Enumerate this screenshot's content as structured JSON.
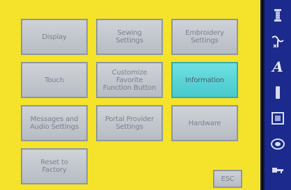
{
  "menu": {
    "display": "Display",
    "sewing_settings": "Sewing\nSettings",
    "embroidery_settings": "Embroidery\nSettings",
    "touch": "Touch",
    "favorite_function_button": "Customize\nFavorite\nFunction Button",
    "information": "Information",
    "messages_audio": "Messages and\nAudio Settings",
    "portal_provider": "Portal Provider\nSettings",
    "hardware": "Hardware",
    "reset_factory": "Reset to\nFactory",
    "esc": "ESC"
  },
  "colors": {
    "background": "#f4e32a",
    "tile": "#c4c8ce",
    "active_tile": "#5fd6d8",
    "sidebar": "#1b2a8c"
  },
  "sidebar": {
    "icons": [
      "spool-icon",
      "needle-icon",
      "letter-a-icon",
      "bar-icon",
      "hoop-icon",
      "bobbin-icon",
      "key-icon"
    ],
    "letter": "A"
  }
}
